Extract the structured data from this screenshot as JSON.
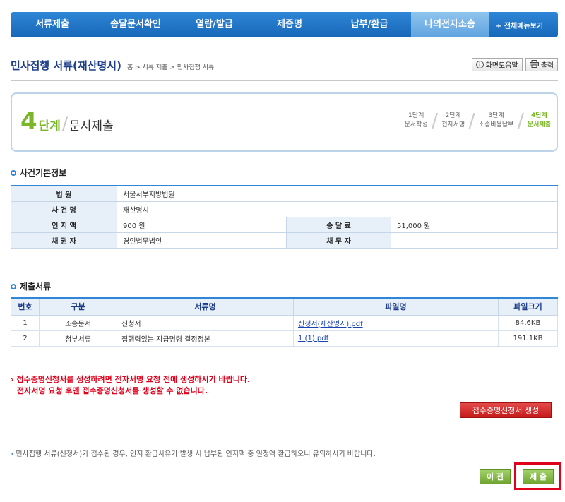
{
  "nav": {
    "items": [
      {
        "label": "서류제출",
        "active": false
      },
      {
        "label": "송달문서확인",
        "active": false
      },
      {
        "label": "열람/발급",
        "active": false
      },
      {
        "label": "제증명",
        "active": false
      },
      {
        "label": "납부/환급",
        "active": false
      },
      {
        "label": "나의전자소송",
        "active": true
      }
    ],
    "all_menu": "+ 전체메뉴보기"
  },
  "header": {
    "title": "민사집행 서류(재산명시)",
    "breadcrumb": "홈 > 서류 제출 > 민사집행 서류",
    "help": "화면도움말",
    "print": "출력"
  },
  "steps": {
    "current_num": "4",
    "current_word": "단계",
    "current_title": "문서제출",
    "items": [
      {
        "step": "1단계",
        "label": "문서작성"
      },
      {
        "step": "2단계",
        "label": "전자서명"
      },
      {
        "step": "3단계",
        "label": "소송비용납부"
      },
      {
        "step": "4단계",
        "label": "문서제출"
      }
    ]
  },
  "case_info": {
    "title": "사건기본정보",
    "court_label": "법 원",
    "court": "서울서부지방법원",
    "case_label": "사 건 명",
    "case": "재산명시",
    "stamp_label": "인 지 액",
    "stamp": "900 원",
    "service_label": "송 달 료",
    "service": "51,000 원",
    "creditor_label": "채 권 자",
    "creditor": "경인법무법인",
    "debtor_label": "채 무 자",
    "debtor": ""
  },
  "docs": {
    "title": "제출서류",
    "headers": [
      "번호",
      "구분",
      "서류명",
      "파일명",
      "파일크기"
    ],
    "rows": [
      {
        "no": "1",
        "type": "소송문서",
        "name": "신청서",
        "file": "신청서(재산명시).pdf",
        "size": "84.6KB"
      },
      {
        "no": "2",
        "type": "첨부서류",
        "name": "집행력있는 지급명령 결정정본",
        "file": "1 (1).pdf",
        "size": "191.1KB"
      }
    ]
  },
  "warning": {
    "line1": "접수증명신청서를 생성하려면 전자서명 요청 전에 생성하시기 바랍니다.",
    "line2": "전자서명 요청 후엔 접수증명신청서를 생성할 수 없습니다."
  },
  "generate_button": "접수증명신청서 생성",
  "notice": "민사집행 서류(신청서)가 접수된 경우, 인지 환급사유가 발생 시 납부된 인지액 중 일정액 환급하오니 유의하시기 바랍니다.",
  "buttons": {
    "prev": "이 전",
    "submit": "제 출"
  }
}
